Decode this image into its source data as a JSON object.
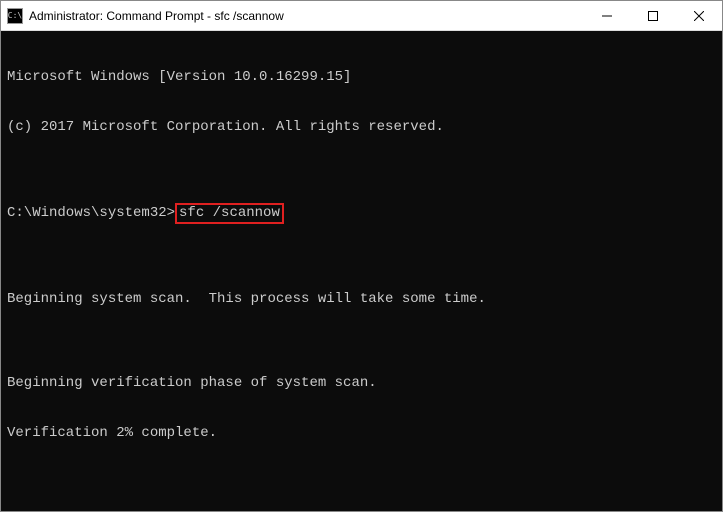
{
  "window": {
    "title": "Administrator: Command Prompt - sfc  /scannow",
    "icon_label": "C:\\"
  },
  "terminal": {
    "line1": "Microsoft Windows [Version 10.0.16299.15]",
    "line2": "(c) 2017 Microsoft Corporation. All rights reserved.",
    "blank1": "",
    "prompt": "C:\\Windows\\system32>",
    "command": "sfc /scannow",
    "blank2": "",
    "line_scan": "Beginning system scan.  This process will take some time.",
    "blank3": "",
    "line_verify": "Beginning verification phase of system scan.",
    "line_progress": "Verification 2% complete."
  }
}
